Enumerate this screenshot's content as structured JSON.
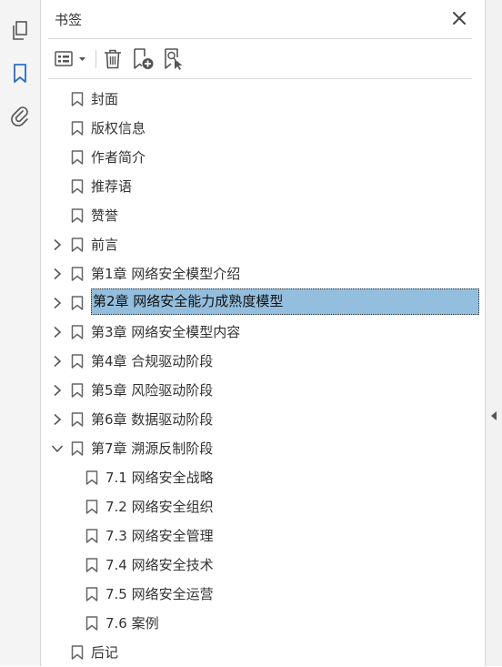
{
  "panel": {
    "title": "书签"
  },
  "colors": {
    "selection": "#94bedd",
    "accent": "#2b6cc4",
    "icon": "#555555"
  },
  "left_rail": {
    "icons": [
      "pages-icon",
      "bookmark-icon",
      "attachment-icon"
    ],
    "active": "bookmark-icon"
  },
  "toolbar": {
    "icons": [
      "options-menu-icon",
      "delete-bookmark-icon",
      "new-bookmark-icon",
      "find-bookmark-icon"
    ]
  },
  "bookmarks": [
    {
      "label": "封面",
      "level": 0,
      "expander": "none"
    },
    {
      "label": "版权信息",
      "level": 0,
      "expander": "none"
    },
    {
      "label": "作者简介",
      "level": 0,
      "expander": "none"
    },
    {
      "label": "推荐语",
      "level": 0,
      "expander": "none"
    },
    {
      "label": "赞誉",
      "level": 0,
      "expander": "none"
    },
    {
      "label": "前言",
      "level": 0,
      "expander": "collapsed"
    },
    {
      "label": "第1章 网络安全模型介绍",
      "level": 0,
      "expander": "collapsed"
    },
    {
      "label": "第2章 网络安全能力成熟度模型",
      "level": 0,
      "expander": "collapsed",
      "selected": true
    },
    {
      "label": "第3章 网络安全模型内容",
      "level": 0,
      "expander": "collapsed"
    },
    {
      "label": "第4章 合规驱动阶段",
      "level": 0,
      "expander": "collapsed"
    },
    {
      "label": "第5章 风险驱动阶段",
      "level": 0,
      "expander": "collapsed"
    },
    {
      "label": "第6章 数据驱动阶段",
      "level": 0,
      "expander": "collapsed"
    },
    {
      "label": "第7章 溯源反制阶段",
      "level": 0,
      "expander": "expanded"
    },
    {
      "label": "7.1 网络安全战略",
      "level": 1,
      "expander": "none"
    },
    {
      "label": "7.2 网络安全组织",
      "level": 1,
      "expander": "none"
    },
    {
      "label": "7.3 网络安全管理",
      "level": 1,
      "expander": "none"
    },
    {
      "label": "7.4 网络安全技术",
      "level": 1,
      "expander": "none"
    },
    {
      "label": "7.5 网络安全运营",
      "level": 1,
      "expander": "none"
    },
    {
      "label": "7.6 案例",
      "level": 1,
      "expander": "none"
    },
    {
      "label": "后记",
      "level": 0,
      "expander": "none"
    }
  ]
}
